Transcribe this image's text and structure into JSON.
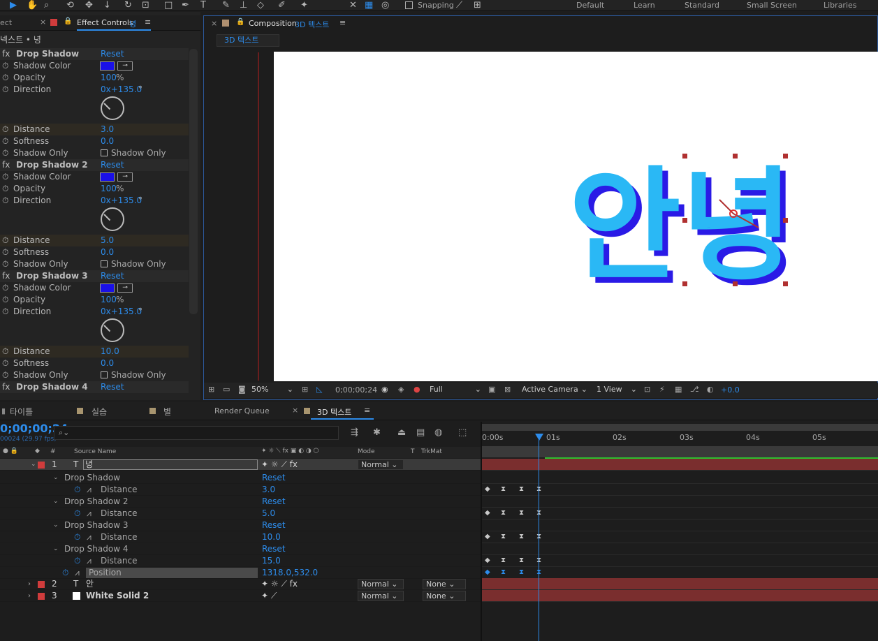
{
  "toolbar": {
    "snapping": "Snapping",
    "workspaces": [
      "Default",
      "Learn",
      "Standard",
      "Small Screen",
      "Libraries"
    ]
  },
  "effect_controls": {
    "tab_left": "ect",
    "tab_title": "Effect Controls",
    "tab_layer": "녕",
    "breadcrumb": "넥스트 • 녕",
    "effects": [
      {
        "name": "Drop Shadow",
        "reset": "Reset",
        "opacity": "100",
        "direction": "0x+135.0",
        "distance": "3.0",
        "softness": "0.0"
      },
      {
        "name": "Drop Shadow 2",
        "reset": "Reset",
        "opacity": "100",
        "direction": "0x+135.0",
        "distance": "5.0",
        "softness": "0.0"
      },
      {
        "name": "Drop Shadow 3",
        "reset": "Reset",
        "opacity": "100",
        "direction": "0x+135.0",
        "distance": "10.0",
        "softness": "0.0"
      },
      {
        "name": "Drop Shadow 4",
        "reset": "Reset"
      }
    ],
    "labels": {
      "shadow_color": "Shadow Color",
      "opacity": "Opacity",
      "direction": "Direction",
      "distance": "Distance",
      "softness": "Softness",
      "shadow_only": "Shadow Only",
      "percent": "%",
      "degree": "°"
    },
    "colors": {
      "shadow": "#1a10e8"
    }
  },
  "composition": {
    "tab_prefix": "Composition",
    "tab_name": "3D 텍스트",
    "subtab": "3D 텍스트",
    "canvas_text": "안녕",
    "text_color": "#2ab8f5",
    "extrude_color": "#2a1ae6"
  },
  "compbar": {
    "zoom": "50%",
    "timecode": "0;00;00;24",
    "resolution": "Full",
    "camera": "Active Camera",
    "views": "1 View",
    "exposure": "+0.0"
  },
  "timeline": {
    "tabs": [
      "타이틀",
      "실습",
      "별",
      "Render Queue",
      "3D 텍스트"
    ],
    "timecode": "0;00;00;24",
    "fps": "00024 (29.97 fps)",
    "columns": {
      "source": "Source Name",
      "mode": "Mode",
      "t": "T",
      "trkmat": "TrkMat"
    },
    "ruler": [
      "0:00s",
      "01s",
      "02s",
      "03s",
      "04s",
      "05s"
    ],
    "layers": [
      {
        "num": "1",
        "name": "녕",
        "mode": "Normal"
      },
      {
        "num": "2",
        "name": "안",
        "mode": "Normal",
        "trk": "None"
      },
      {
        "num": "3",
        "name": "White Solid 2",
        "mode": "Normal",
        "trk": "None"
      }
    ],
    "props": [
      {
        "name": "Drop Shadow",
        "value": "Reset"
      },
      {
        "name": "Distance",
        "value": "3.0"
      },
      {
        "name": "Drop Shadow 2",
        "value": "Reset"
      },
      {
        "name": "Distance",
        "value": "5.0"
      },
      {
        "name": "Drop Shadow 3",
        "value": "Reset"
      },
      {
        "name": "Distance",
        "value": "10.0"
      },
      {
        "name": "Drop Shadow 4",
        "value": "Reset"
      },
      {
        "name": "Distance",
        "value": "15.0"
      },
      {
        "name": "Position",
        "value": "1318.0,532.0"
      }
    ]
  }
}
